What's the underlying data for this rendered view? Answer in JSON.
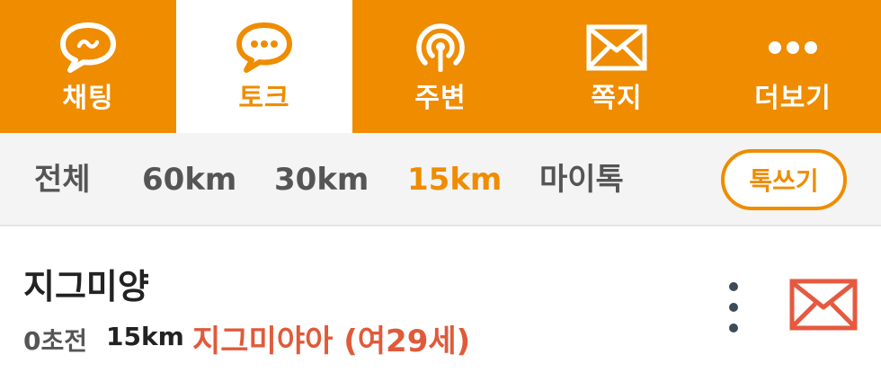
{
  "nav": {
    "tabs": [
      {
        "label": "채팅",
        "icon": "chat-bubble-icon",
        "active": false
      },
      {
        "label": "토크",
        "icon": "talk-bubble-icon",
        "active": true
      },
      {
        "label": "주변",
        "icon": "nearby-signal-icon",
        "active": false
      },
      {
        "label": "쪽지",
        "icon": "envelope-icon",
        "active": false
      },
      {
        "label": "더보기",
        "icon": "more-dots-icon",
        "active": false
      }
    ]
  },
  "filters": {
    "items": [
      {
        "label": "전체",
        "active": false
      },
      {
        "label": "60km",
        "active": false
      },
      {
        "label": "30km",
        "active": false
      },
      {
        "label": "15km",
        "active": true
      },
      {
        "label": "마이톡",
        "active": false
      }
    ],
    "write_label": "톡쓰기"
  },
  "post": {
    "name": "지그미양",
    "time": "0초전",
    "distance": "15km",
    "nickname": "지그미야아 (여29세)"
  },
  "colors": {
    "accent": "#ef8c00",
    "nickname": "#e05a3a",
    "mail_icon": "#e55a3f"
  }
}
